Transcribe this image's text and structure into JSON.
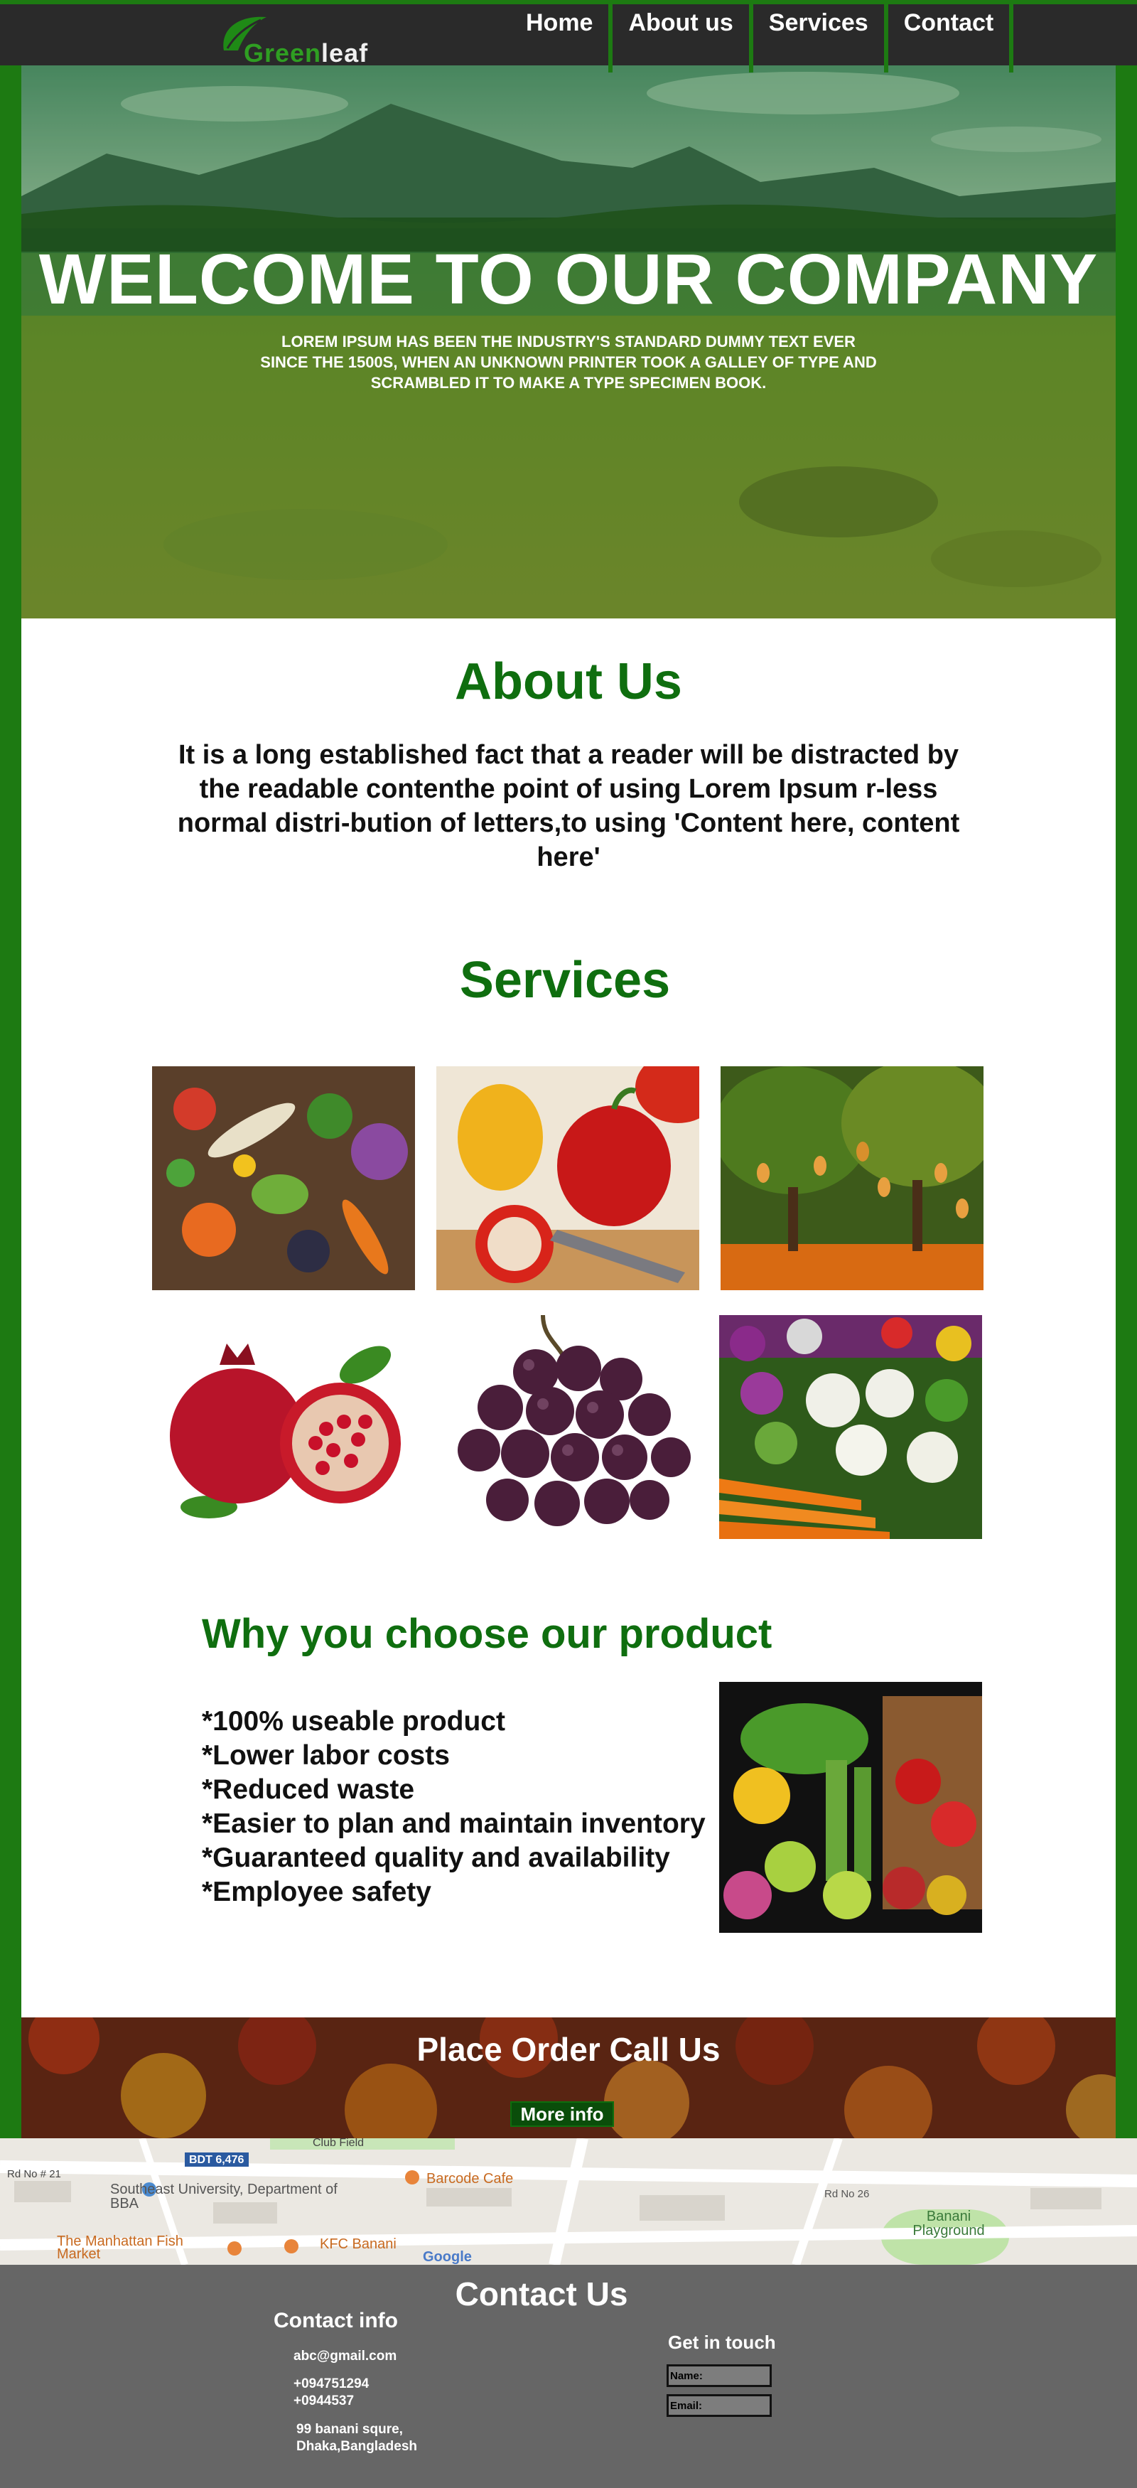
{
  "nav": {
    "logo_green": "Green",
    "logo_white": "leaf",
    "items": [
      "Home",
      "About us",
      "Services",
      "Contact"
    ]
  },
  "hero": {
    "title": "WELCOME TO OUR COMPANY",
    "text": "LOREM IPSUM HAS BEEN THE INDUSTRY'S STANDARD DUMMY TEXT EVER SINCE THE 1500S, WHEN AN UNKNOWN PRINTER TOOK A GALLEY OF TYPE AND SCRAMBLED IT TO MAKE A TYPE SPECIMEN BOOK."
  },
  "about": {
    "title": "About Us",
    "text": "It is a long established fact that a reader will be distracted by the readable contenthe point of using Lorem Ipsum r-less normal distri-bution of letters,to using 'Content here, content here'"
  },
  "services": {
    "title": "Services",
    "tiles": [
      "vegetables-photo",
      "peppers-photo",
      "mango-tree-photo",
      "pomegranate-photo",
      "grapes-photo",
      "market-vegetables-photo"
    ]
  },
  "why": {
    "title": "Why you choose our product",
    "items": [
      "*100% useable product",
      "*Lower labor costs",
      "*Reduced waste",
      "*Easier to plan and maintain inventory",
      "*Guaranteed quality and availability",
      "*Employee safety"
    ]
  },
  "order": {
    "title": "Place Order Call Us",
    "button": "More info"
  },
  "map": {
    "labels": [
      "Club Field",
      "Rd No # 21",
      "BDT 6,476",
      "Southeast University, Department of BBA",
      "Barcode Cafe",
      "The Manhattan Fish Market",
      "KFC Banani",
      "Rd No 26",
      "Banani Playground",
      "Google"
    ]
  },
  "contact": {
    "title": "Contact Us",
    "info_title": "Contact info",
    "email": "abc@gmail.com",
    "phone1": "+094751294",
    "phone2": "+0944537",
    "address1": "99 banani squre,",
    "address2": "Dhaka,Bangladesh",
    "touch_title": "Get in touch",
    "name_placeholder": "Name:",
    "email_placeholder": "Email:"
  },
  "colors": {
    "brand_green": "#1d7a12",
    "heading_green": "#0f6e0f",
    "nav_bg": "#2a2a2a",
    "footer_bg": "#666666"
  }
}
